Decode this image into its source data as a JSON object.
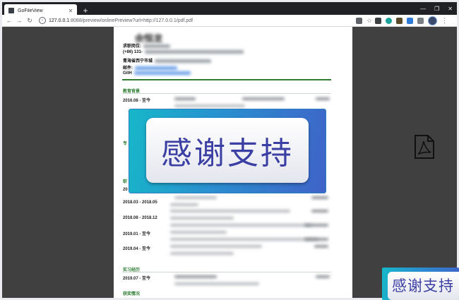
{
  "browser": {
    "tab_title": "GoFileView",
    "close_tab": "✕",
    "new_tab": "+",
    "window_buttons": [
      "—",
      "❐",
      "✕"
    ],
    "url_host": "127.0.0.1",
    "url_rest": ":8088/preview/onlinePreview?url=http://127.0.0.1/pdf.pdf"
  },
  "resume": {
    "name": "佘恒龙",
    "labels": {
      "job": "求职岗位:",
      "phone": "(+86) 131-",
      "address": "青海省西宁市城",
      "email": "邮件:",
      "github": "GitH"
    },
    "sections": {
      "education": "教育背景",
      "skills_partial": "专",
      "work_partial": "职",
      "internship": "实习经历",
      "awards": "获奖情况"
    },
    "dates": [
      "2016.08 - 至今",
      "20",
      "2018.03 - 2018.05",
      "2018.08 - 2018.12",
      "2019.01 - 至今",
      "2019.04 - 至今",
      "2019.07 - 至今"
    ]
  },
  "banner_text": "感谢支持",
  "colors": {
    "accent_green": "#2e7d32",
    "viewer_bg": "#404040",
    "banner_start": "#17b7c9",
    "banner_end": "#3f63c8",
    "banner_text": "#3b3fa3"
  },
  "icons": [
    "favicon-icon",
    "back-icon",
    "forward-icon",
    "reload-icon",
    "info-icon",
    "translate-icon",
    "star-icon",
    "pdf-icon"
  ]
}
